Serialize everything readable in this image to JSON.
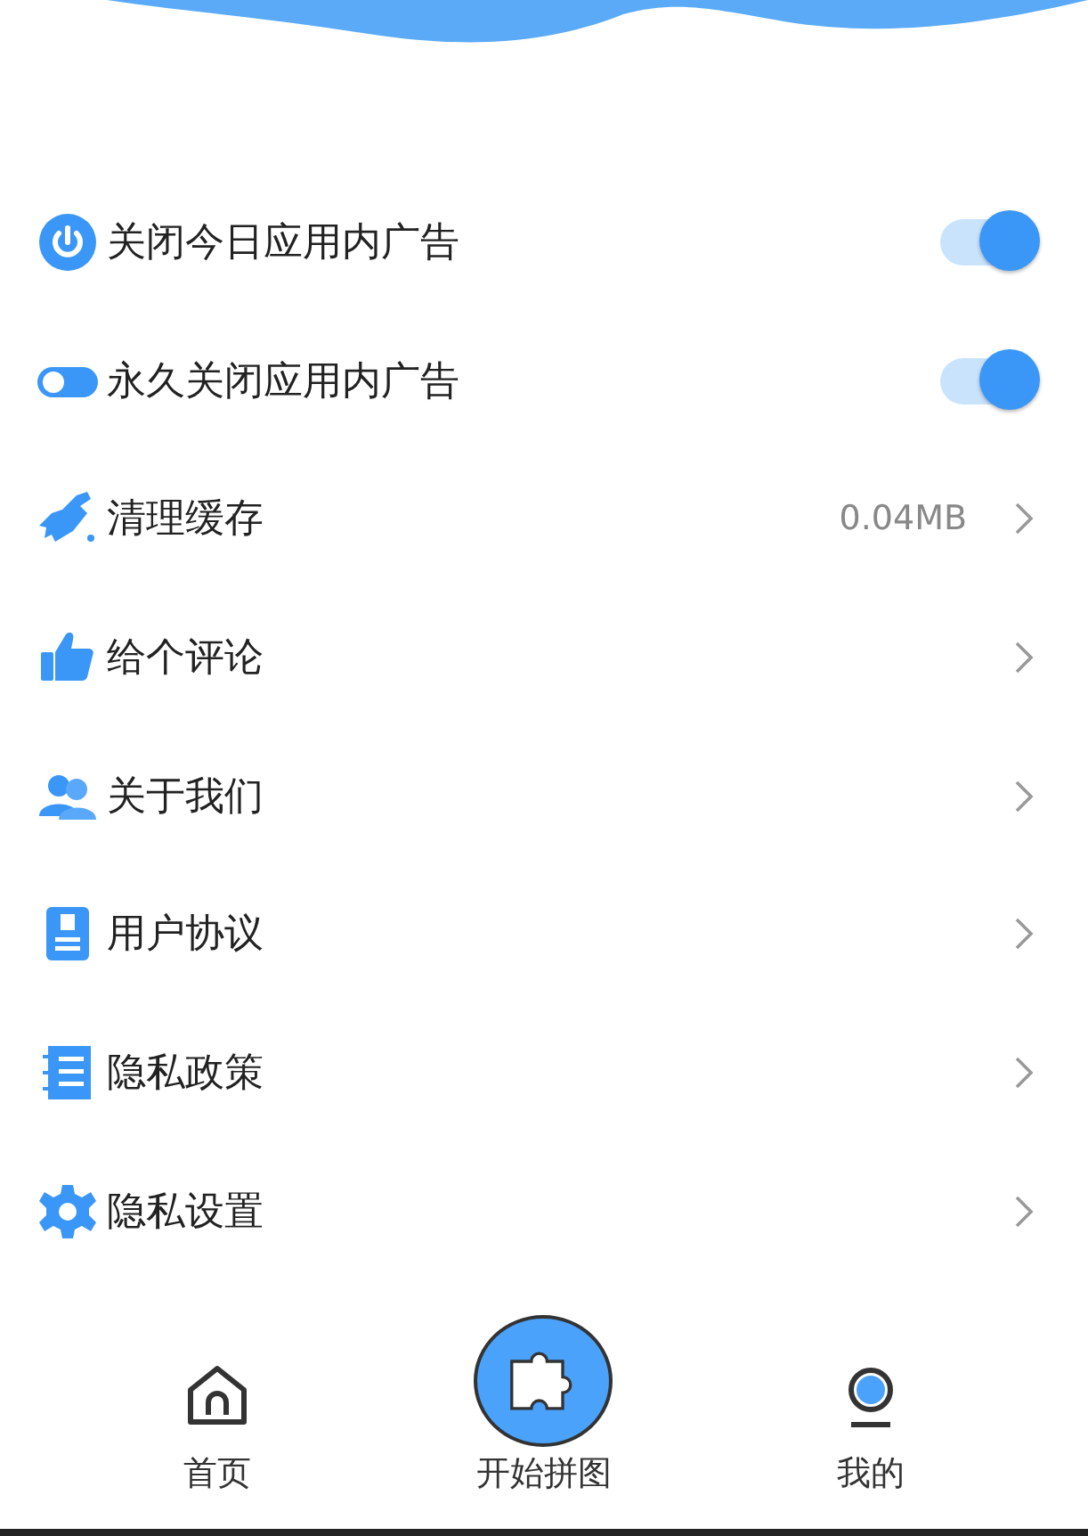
{
  "settings": [
    {
      "kind": "toggle",
      "label": "关闭今日应用内广告",
      "on": true
    },
    {
      "kind": "toggle",
      "label": "永久关闭应用内广告",
      "on": true
    },
    {
      "kind": "link",
      "label": "清理缓存",
      "value": "0.04MB"
    },
    {
      "kind": "link",
      "label": "给个评论"
    },
    {
      "kind": "link",
      "label": "关于我们"
    },
    {
      "kind": "link",
      "label": "用户协议"
    },
    {
      "kind": "link",
      "label": "隐私政策"
    },
    {
      "kind": "link",
      "label": "隐私设置"
    }
  ],
  "bottom_nav": [
    {
      "label": "首页",
      "selected": false
    },
    {
      "label": "开始拼图",
      "selected": false
    },
    {
      "label": "我的",
      "selected": true
    }
  ]
}
